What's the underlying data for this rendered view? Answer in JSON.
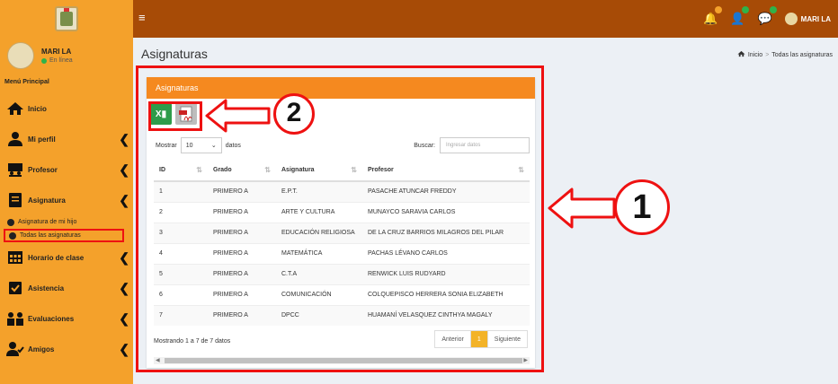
{
  "topbar": {
    "menu_icon": "hamburger-icon",
    "notifications": [
      {
        "icon": "bell-icon",
        "badge_color": "#f4a12b"
      },
      {
        "icon": "user-plus-icon",
        "badge_color": "#2fb34a"
      },
      {
        "icon": "chat-icon",
        "badge_color": "#2fb34a"
      }
    ],
    "user_name": "MARI LA"
  },
  "sidebar": {
    "user": {
      "name": "MARI LA",
      "status": "En línea"
    },
    "menu_header": "Menú Principal",
    "items": [
      {
        "label": "Inicio",
        "icon": "home-icon",
        "chevron": false
      },
      {
        "label": "Mi perfil",
        "icon": "user-icon",
        "chevron": true
      },
      {
        "label": "Profesor",
        "icon": "teacher-icon",
        "chevron": true
      },
      {
        "label": "Asignatura",
        "icon": "book-icon",
        "chevron": true
      },
      {
        "label": "Horario de clase",
        "icon": "calendar-icon",
        "chevron": true
      },
      {
        "label": "Asistencia",
        "icon": "checkbox-icon",
        "chevron": true
      },
      {
        "label": "Evaluaciones",
        "icon": "users-icon",
        "chevron": true
      },
      {
        "label": "Amigos",
        "icon": "user-check-icon",
        "chevron": true
      }
    ],
    "sub_items": [
      {
        "label": "Asignatura de mi hijo"
      },
      {
        "label": "Todas las asignaturas",
        "active": true
      }
    ]
  },
  "page": {
    "title": "Asignaturas",
    "breadcrumb": {
      "home": "Inicio",
      "current": "Todas las asignaturas"
    }
  },
  "box": {
    "title": "Asignaturas",
    "export": {
      "excel_icon": "excel-icon",
      "pdf_icon": "pdf-icon"
    },
    "length": {
      "before": "Mostrar",
      "value": "10",
      "after": "datos"
    },
    "search": {
      "label": "Buscar:",
      "placeholder": "Ingresar datos"
    },
    "columns": [
      "ID",
      "Grado",
      "Asignatura",
      "Profesor"
    ],
    "rows": [
      [
        "1",
        "PRIMERO A",
        "E.P.T.",
        "PASACHE ATUNCAR FREDDY"
      ],
      [
        "2",
        "PRIMERO A",
        "ARTE Y CULTURA",
        "MUNAYCO SARAVIA CARLOS"
      ],
      [
        "3",
        "PRIMERO A",
        "EDUCACIÓN RELIGIOSA",
        "DE LA CRUZ BARRIOS MILAGROS DEL PILAR"
      ],
      [
        "4",
        "PRIMERO A",
        "MATEMÁTICA",
        "PACHAS LÉVANO CARLOS"
      ],
      [
        "5",
        "PRIMERO A",
        "C.T.A",
        "RENWICK LUIS RUDYARD"
      ],
      [
        "6",
        "PRIMERO A",
        "COMUNICACIÓN",
        "COLQUEPISCO HERRERA SONIA ELIZABETH"
      ],
      [
        "7",
        "PRIMERO A",
        "DPCC",
        "HUAMANÍ VELASQUEZ CINTHYA MAGALY"
      ]
    ],
    "info": "Mostrando 1 a 7 de 7 datos",
    "pager": {
      "prev": "Anterior",
      "current": "1",
      "next": "Siguiente"
    }
  },
  "annotations": {
    "label_1": "1",
    "label_2": "2",
    "color": "#ee1111"
  }
}
